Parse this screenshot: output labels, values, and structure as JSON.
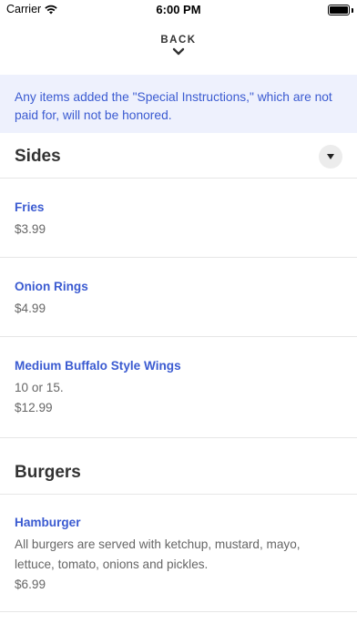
{
  "status_bar": {
    "carrier": "Carrier",
    "time": "6:00 PM",
    "battery_level": 1.0,
    "icons": [
      "wifi-icon",
      "battery-icon"
    ]
  },
  "back_button": {
    "label": "BACK",
    "icon": "chevron-down-icon"
  },
  "notice": {
    "line1": "Any items added the \"Special Instructions,\" which are not",
    "line2": "paid for, will not be honored."
  },
  "sections": [
    {
      "title": "Sides",
      "dropdown_icon": "caret-down-icon",
      "items": [
        {
          "name": "Fries",
          "price": "$3.99"
        },
        {
          "name": "Onion Rings",
          "price": "$4.99"
        },
        {
          "name": "Medium Buffalo Style Wings",
          "description": "10 or 15.",
          "price": "$12.99"
        }
      ]
    },
    {
      "title": "Burgers",
      "items": [
        {
          "name": "Hamburger",
          "description_line1": "All burgers are served with ketchup, mustard, mayo,",
          "description_line2": "lettuce, tomato, onions and pickles.",
          "price": "$6.99"
        }
      ]
    }
  ],
  "colors": {
    "accent": "#3b5bd1",
    "notice_background": "#eef1fd",
    "divider": "#e6e6e6",
    "text_primary": "#333333",
    "text_secondary": "#666666"
  }
}
